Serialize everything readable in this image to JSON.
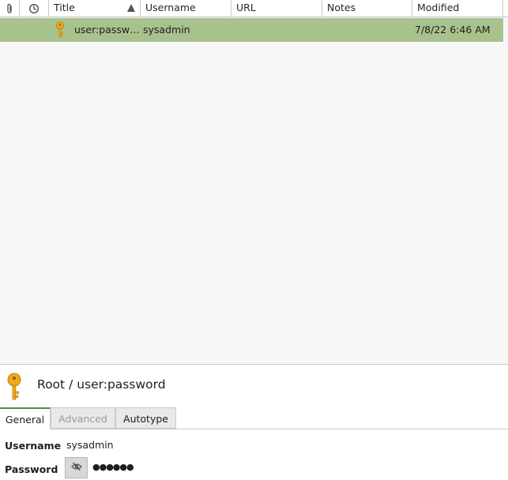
{
  "columns": {
    "title": "Title",
    "username": "Username",
    "url": "URL",
    "notes": "Notes",
    "modified": "Modified"
  },
  "icons": {
    "attachment": "paperclip-icon",
    "expiry": "clock-icon",
    "entry": "key-icon",
    "password_toggle": "eye-slash-icon"
  },
  "entries": [
    {
      "title": "user:passw…",
      "username": "sysadmin",
      "url": "",
      "notes": "",
      "modified": "7/8/22 6:46 AM",
      "selected": true
    }
  ],
  "preview": {
    "title": "Root / user:password",
    "tabs": [
      "General",
      "Advanced",
      "Autotype"
    ],
    "username_label": "Username",
    "username_value": "sysadmin",
    "password_label": "Password",
    "password_mask": "●●●●●●"
  },
  "colors": {
    "selection": "#a8c28e",
    "key": "#f0a818",
    "tab_accent": "#5c8a3a"
  }
}
